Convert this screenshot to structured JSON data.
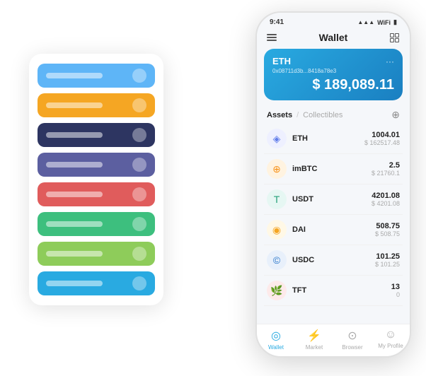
{
  "bg_card": {
    "rows": [
      {
        "color": "#5eb5f7",
        "id": "blue-light"
      },
      {
        "color": "#f5a623",
        "id": "orange"
      },
      {
        "color": "#2d3561",
        "id": "dark-navy"
      },
      {
        "color": "#5c5fa0",
        "id": "purple"
      },
      {
        "color": "#e05c5c",
        "id": "red"
      },
      {
        "color": "#3dbf7e",
        "id": "green"
      },
      {
        "color": "#8ecc5a",
        "id": "lime"
      },
      {
        "color": "#29aae1",
        "id": "blue"
      }
    ]
  },
  "phone": {
    "status": {
      "time": "9:41",
      "signal": "●●●",
      "wifi": "wifi",
      "battery": "▮"
    },
    "header": {
      "title": "Wallet"
    },
    "eth_card": {
      "name": "ETH",
      "address": "0x08711d3b...8418a78e3",
      "balance": "$ 189,089.11"
    },
    "assets": {
      "tab_active": "Assets",
      "tab_separator": "/",
      "tab_inactive": "Collectibles"
    },
    "asset_list": [
      {
        "symbol": "ETH",
        "icon": "◈",
        "icon_color": "#627eea",
        "icon_bg": "#eef0ff",
        "amount": "1004.01",
        "value": "$ 162517.48"
      },
      {
        "symbol": "imBTC",
        "icon": "⊕",
        "icon_color": "#f7931a",
        "icon_bg": "#fff3e0",
        "amount": "2.5",
        "value": "$ 21760.1"
      },
      {
        "symbol": "USDT",
        "icon": "T",
        "icon_color": "#26a17b",
        "icon_bg": "#e6f7f3",
        "amount": "4201.08",
        "value": "$ 4201.08"
      },
      {
        "symbol": "DAI",
        "icon": "◉",
        "icon_color": "#f5a623",
        "icon_bg": "#fff8e6",
        "amount": "508.75",
        "value": "$ 508.75"
      },
      {
        "symbol": "USDC",
        "icon": "©",
        "icon_color": "#2775ca",
        "icon_bg": "#e8f0fb",
        "amount": "101.25",
        "value": "$ 101.25"
      },
      {
        "symbol": "TFT",
        "icon": "🌿",
        "icon_color": "#e05c5c",
        "icon_bg": "#fdeaea",
        "amount": "13",
        "value": "0"
      }
    ],
    "nav": {
      "items": [
        {
          "label": "Wallet",
          "icon": "◎",
          "active": true
        },
        {
          "label": "Market",
          "icon": "⚡",
          "active": false
        },
        {
          "label": "Browser",
          "icon": "⊙",
          "active": false
        },
        {
          "label": "My Profile",
          "icon": "☺",
          "active": false
        }
      ]
    }
  }
}
